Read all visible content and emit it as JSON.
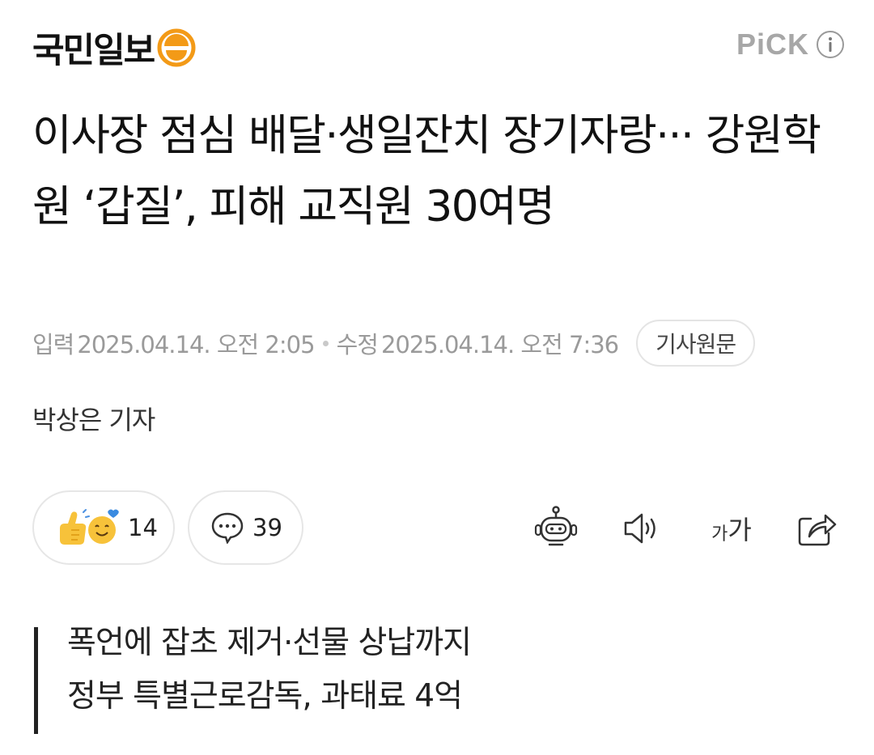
{
  "header": {
    "logo_text": "국민일보",
    "pick_label": "PiCK",
    "info_icon": "info-icon"
  },
  "article": {
    "title": "이사장 점심 배달·생일잔치 장기자랑··· 강원학원 ‘갑질’, 피해 교직원 30여명",
    "input_label": "입력",
    "input_time": "2025.04.14. 오전 2:05",
    "modified_label": "수정",
    "modified_time": "2025.04.14. 오전 7:36",
    "source_button": "기사원문",
    "reporter": "박상은 기자"
  },
  "reactions": {
    "react_icon": "thumbs-up-smile-icon",
    "react_count": "14",
    "comment_icon": "comment-bubble-icon",
    "comment_count": "39"
  },
  "toolbar": {
    "robot_icon": "robot-summary-icon",
    "speaker_icon": "speaker-icon",
    "font_size_label": "가가",
    "share_icon": "share-icon"
  },
  "summary": {
    "lines": [
      "폭언에 잡초 제거·선물 상납까지",
      "정부 특별근로감독, 과태료 4억"
    ]
  },
  "colors": {
    "logo_orange": "#f39a17",
    "muted_gray": "#9a9a9a",
    "border_gray": "#e4e4e4",
    "summary_bar": "#222222"
  }
}
